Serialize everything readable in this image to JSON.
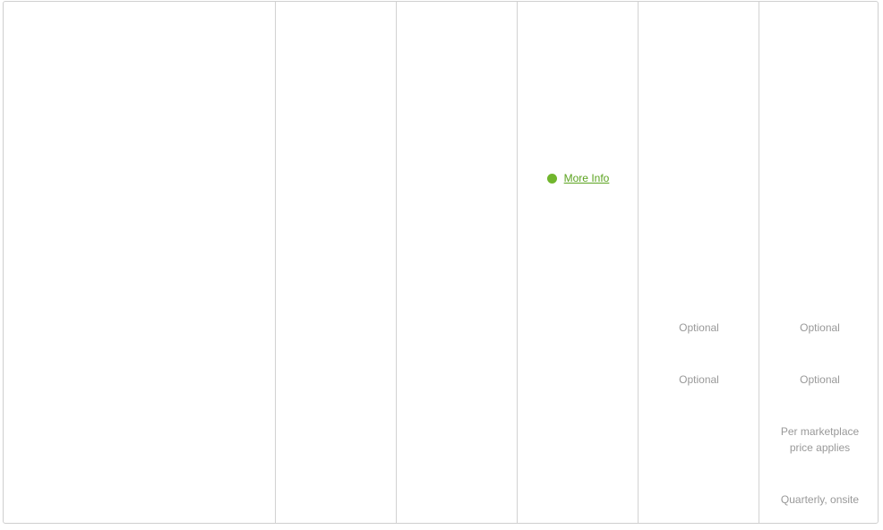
{
  "colors": {
    "border": "#cfcfcf",
    "divider": "#d2d2d2",
    "muted_text": "#999999",
    "accent_green": "#71b62d",
    "link_green": "#5ba31f"
  },
  "column4": {
    "more_info": {
      "icon": "green-dot-icon",
      "label": "More Info"
    }
  },
  "column5": {
    "row1": "Optional",
    "row2": "Optional"
  },
  "column6": {
    "row1": "Optional",
    "row2": "Optional",
    "row3_line1": "Per marketplace",
    "row3_line2": "price applies",
    "row4": "Quarterly, onsite"
  }
}
